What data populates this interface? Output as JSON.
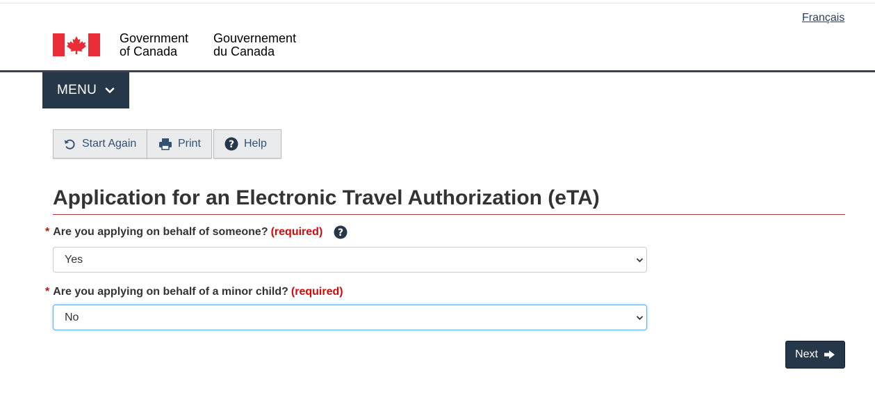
{
  "header": {
    "language_link": "Français",
    "signature_en_line1": "Government",
    "signature_en_line2": "of Canada",
    "signature_fr_line1": "Gouvernement",
    "signature_fr_line2": "du Canada",
    "flag_icon": "canada-flag-icon"
  },
  "menu": {
    "label": "MENU",
    "icon": "chevron-down-icon"
  },
  "toolbar": {
    "start_again_label": "Start Again",
    "print_label": "Print",
    "help_label": "Help"
  },
  "main": {
    "title": "Application for an Electronic Travel Authorization (eTA)",
    "questions": [
      {
        "asterisk": "*",
        "label": "Are you applying on behalf of someone?",
        "required_text": "(required)",
        "value": "Yes"
      },
      {
        "asterisk": "*",
        "label": "Are you applying on behalf of a minor child?",
        "required_text": "(required)",
        "value": "No"
      }
    ],
    "next_label": "Next"
  },
  "colors": {
    "brand_dark": "#26374a",
    "required_red": "#d3080c",
    "title_rule": "#af3c43",
    "link": "#284162"
  }
}
